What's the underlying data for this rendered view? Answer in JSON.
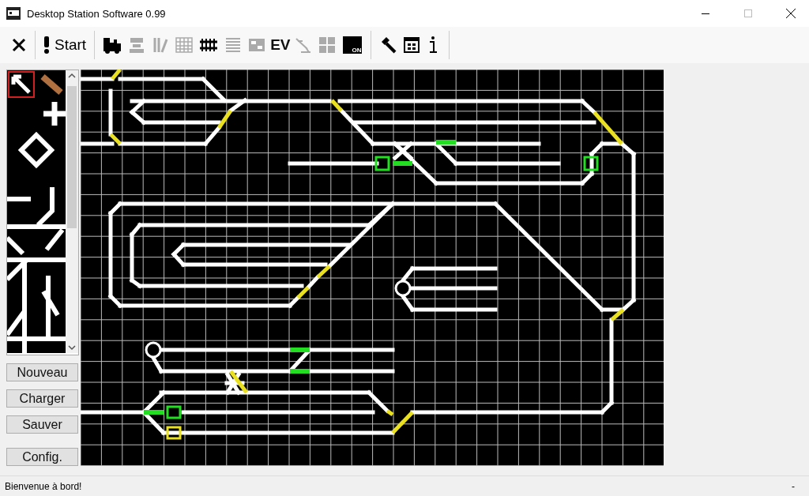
{
  "window": {
    "title": "Desktop Station Software 0.99"
  },
  "toolbar": {
    "items": [
      {
        "kind": "close",
        "disabled": false
      },
      {
        "kind": "start",
        "label": "Start",
        "disabled": false
      },
      {
        "kind": "locomotive",
        "disabled": false
      },
      {
        "kind": "signal",
        "disabled": true
      },
      {
        "kind": "turnout",
        "disabled": true
      },
      {
        "kind": "grid",
        "disabled": true
      },
      {
        "kind": "track",
        "disabled": false
      },
      {
        "kind": "list",
        "disabled": true
      },
      {
        "kind": "panel",
        "disabled": true
      },
      {
        "kind": "text",
        "label": "EV",
        "disabled": false
      },
      {
        "kind": "crane",
        "disabled": true
      },
      {
        "kind": "tiles",
        "disabled": true
      },
      {
        "kind": "power",
        "label": "ON",
        "disabled": false
      },
      {
        "kind": "hammer",
        "disabled": false
      },
      {
        "kind": "window",
        "disabled": false
      },
      {
        "kind": "info",
        "disabled": false
      }
    ]
  },
  "palette": {
    "tools": [
      {
        "selected": true
      },
      {
        "selected": false
      }
    ]
  },
  "buttons": [
    {
      "label": "Nouveau"
    },
    {
      "label": "Charger"
    },
    {
      "label": "Sauver"
    },
    {
      "label": "Config."
    }
  ],
  "status_bar": {
    "message": "Bienvenue à bord!",
    "right": "-"
  }
}
